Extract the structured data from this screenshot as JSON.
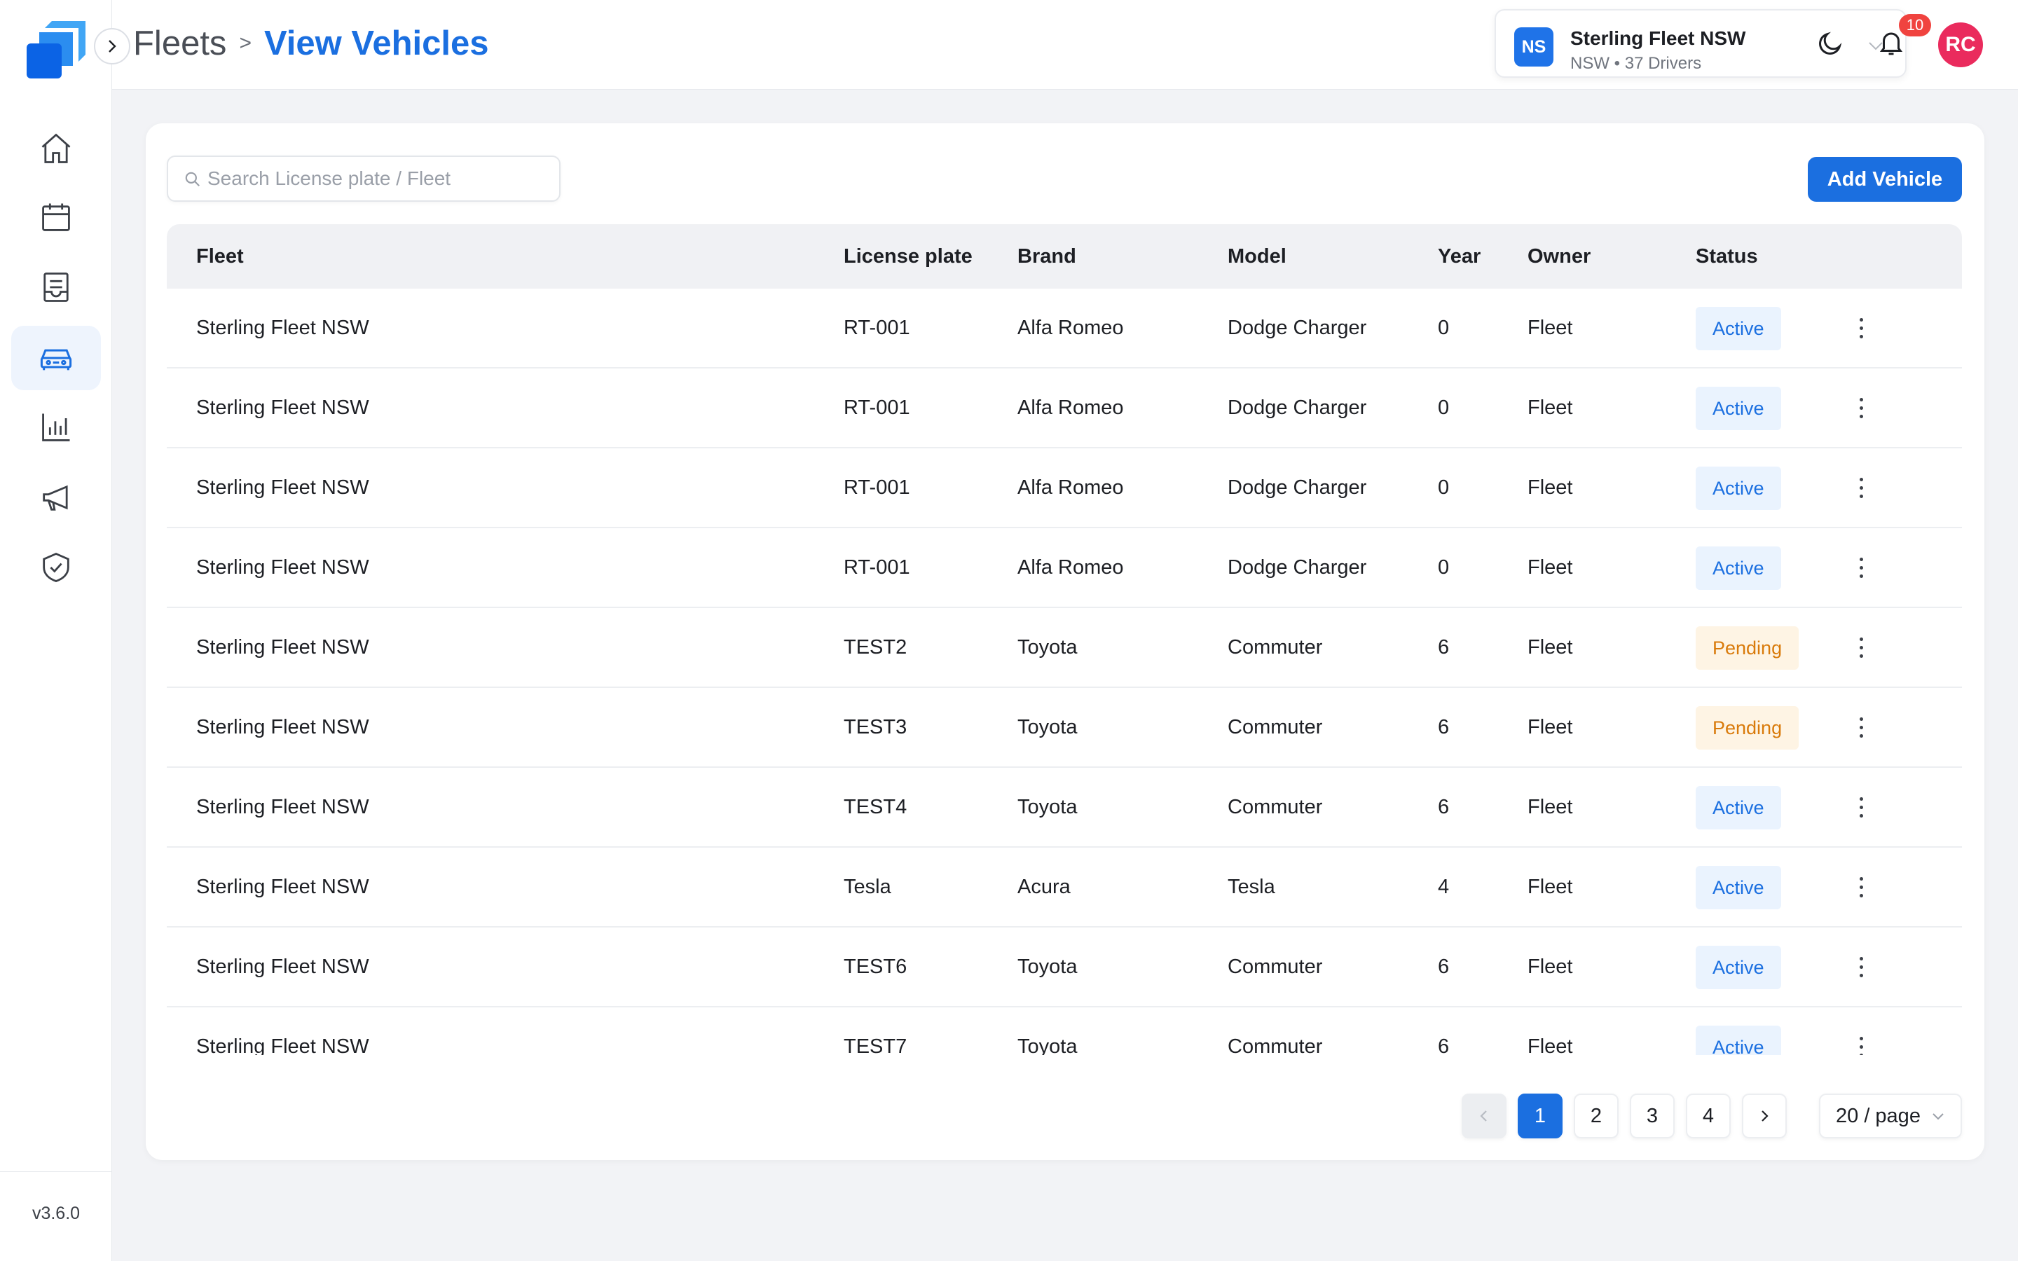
{
  "app": {
    "version": "v3.6.0",
    "colors": {
      "accent": "#1b6fe0",
      "active_bg": "#eaf3fe",
      "pending_text": "#d97a0a",
      "pending_bg": "#fef4e4",
      "notification": "#f0433f",
      "avatar": "#ea2b5d"
    }
  },
  "sidebar": {
    "items": [
      {
        "name": "home",
        "icon": "home-icon",
        "active": false
      },
      {
        "name": "calendar",
        "icon": "calendar-icon",
        "active": false
      },
      {
        "name": "documents",
        "icon": "document-icon",
        "active": false
      },
      {
        "name": "vehicles",
        "icon": "car-icon",
        "active": true
      },
      {
        "name": "reports",
        "icon": "bar-chart-icon",
        "active": false
      },
      {
        "name": "announcements",
        "icon": "megaphone-icon",
        "active": false
      },
      {
        "name": "compliance",
        "icon": "shield-check-icon",
        "active": false
      }
    ]
  },
  "header": {
    "breadcrumb_root": "Fleets",
    "breadcrumb_separator": ">",
    "breadcrumb_current": "View Vehicles",
    "org": {
      "badge": "NS",
      "name": "Sterling Fleet NSW",
      "meta": "NSW • 37 Drivers"
    },
    "notifications_count": "10",
    "avatar_initials": "RC"
  },
  "toolbar": {
    "search_placeholder": "Search License plate / Fleet",
    "search_value": "",
    "add_label": "Add Vehicle"
  },
  "table": {
    "columns": [
      "Fleet",
      "License plate",
      "Brand",
      "Model",
      "Year",
      "Owner",
      "Status"
    ],
    "rows": [
      {
        "fleet": "Sterling Fleet NSW",
        "plate": "RT-001",
        "brand": "Alfa Romeo",
        "model": "Dodge Charger",
        "year": "0",
        "owner": "Fleet",
        "status": "Active"
      },
      {
        "fleet": "Sterling Fleet NSW",
        "plate": "RT-001",
        "brand": "Alfa Romeo",
        "model": "Dodge Charger",
        "year": "0",
        "owner": "Fleet",
        "status": "Active"
      },
      {
        "fleet": "Sterling Fleet NSW",
        "plate": "RT-001",
        "brand": "Alfa Romeo",
        "model": "Dodge Charger",
        "year": "0",
        "owner": "Fleet",
        "status": "Active"
      },
      {
        "fleet": "Sterling Fleet NSW",
        "plate": "RT-001",
        "brand": "Alfa Romeo",
        "model": "Dodge Charger",
        "year": "0",
        "owner": "Fleet",
        "status": "Active"
      },
      {
        "fleet": "Sterling Fleet NSW",
        "plate": "TEST2",
        "brand": "Toyota",
        "model": "Commuter",
        "year": "6",
        "owner": "Fleet",
        "status": "Pending"
      },
      {
        "fleet": "Sterling Fleet NSW",
        "plate": "TEST3",
        "brand": "Toyota",
        "model": "Commuter",
        "year": "6",
        "owner": "Fleet",
        "status": "Pending"
      },
      {
        "fleet": "Sterling Fleet NSW",
        "plate": "TEST4",
        "brand": "Toyota",
        "model": "Commuter",
        "year": "6",
        "owner": "Fleet",
        "status": "Active"
      },
      {
        "fleet": "Sterling Fleet NSW",
        "plate": "Tesla",
        "brand": "Acura",
        "model": "Tesla",
        "year": "4",
        "owner": "Fleet",
        "status": "Active"
      },
      {
        "fleet": "Sterling Fleet NSW",
        "plate": "TEST6",
        "brand": "Toyota",
        "model": "Commuter",
        "year": "6",
        "owner": "Fleet",
        "status": "Active"
      },
      {
        "fleet": "Sterling Fleet NSW",
        "plate": "TEST7",
        "brand": "Toyota",
        "model": "Commuter",
        "year": "6",
        "owner": "Fleet",
        "status": "Active"
      }
    ]
  },
  "pagination": {
    "pages": [
      "1",
      "2",
      "3",
      "4"
    ],
    "current": "1",
    "page_size_label": "20 / page"
  }
}
